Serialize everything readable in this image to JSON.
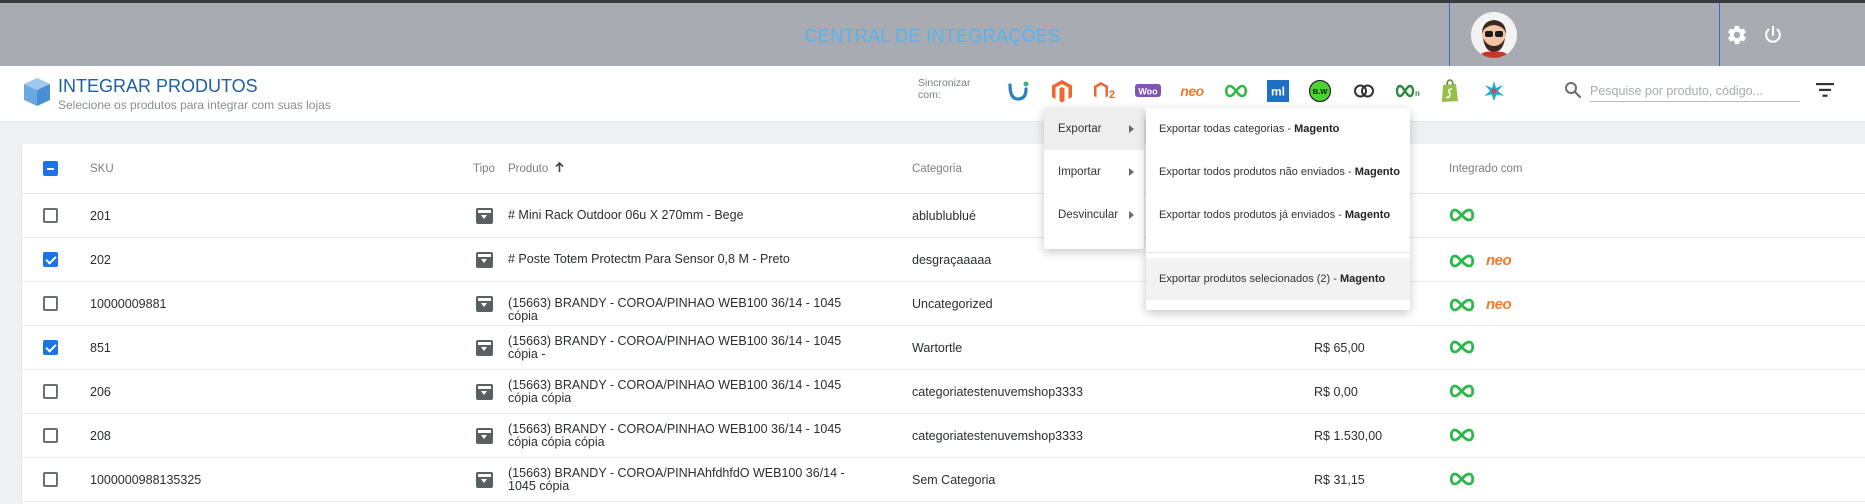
{
  "topbar": {
    "title": "CENTRAL DE INTEGRAÇÕES"
  },
  "header": {
    "title": "INTEGRAR PRODUTOS",
    "subtitle": "Selecione os produtos para integrar com suas lojas",
    "sync_label": "Sincronizar com:"
  },
  "integrations": [
    {
      "icon": "unified-icon",
      "text": ""
    },
    {
      "icon": "magento-icon",
      "text": ""
    },
    {
      "icon": "magento2-icon",
      "text": "2"
    },
    {
      "icon": "woocommerce-icon",
      "text": "Woo"
    },
    {
      "icon": "neo-icon",
      "text": "neo"
    },
    {
      "icon": "infinity-icon",
      "text": ""
    },
    {
      "icon": "mercadolivre-icon",
      "text": "ml"
    },
    {
      "icon": "bw-icon",
      "text": "B.W"
    },
    {
      "icon": "links-icon",
      "text": ""
    },
    {
      "icon": "infinity-n-icon",
      "text": "n"
    },
    {
      "icon": "shopify-icon",
      "text": ""
    },
    {
      "icon": "star-icon",
      "text": ""
    }
  ],
  "search": {
    "placeholder": "Pesquise por produto, código..."
  },
  "table": {
    "headers": {
      "sku": "SKU",
      "tipo": "Tipo",
      "produto": "Produto",
      "categoria": "Categoria",
      "integrado": "Integrado com"
    },
    "rows": [
      {
        "checked": false,
        "sku": "201",
        "produto": "# Mini Rack Outdoor 06u X 270mm - Bege",
        "categoria": "ablublublué",
        "preco": "",
        "integ": [
          "infinity"
        ]
      },
      {
        "checked": true,
        "sku": "202",
        "produto": "# Poste Totem Protectm Para Sensor 0,8 M - Preto",
        "categoria": "desgraçaaaaa",
        "preco": "",
        "integ": [
          "infinity",
          "neo"
        ]
      },
      {
        "checked": false,
        "sku": "10000009881",
        "produto": "(15663) BRANDY - COROA/PINHAO WEB100 36/14 - 1045 cópia",
        "categoria": "Uncategorized",
        "preco": "",
        "integ": [
          "infinity",
          "neo"
        ]
      },
      {
        "checked": true,
        "sku": "851",
        "produto": "(15663) BRANDY - COROA/PINHAO WEB100 36/14 - 1045 cópia -",
        "categoria": "Wartortle",
        "preco": "R$ 65,00",
        "integ": [
          "infinity"
        ]
      },
      {
        "checked": false,
        "sku": "206",
        "produto": "(15663) BRANDY - COROA/PINHAO WEB100 36/14 - 1045 cópia cópia",
        "categoria": "categoriatestenuvemshop3333",
        "preco": "R$ 0,00",
        "integ": [
          "infinity"
        ]
      },
      {
        "checked": false,
        "sku": "208",
        "produto": "(15663) BRANDY - COROA/PINHAO WEB100 36/14 - 1045 cópia cópia cópia",
        "categoria": "categoriatestenuvemshop3333",
        "preco": "R$ 1.530,00",
        "integ": [
          "infinity"
        ]
      },
      {
        "checked": false,
        "sku": "1000000988135325",
        "produto": "(15663) BRANDY - COROA/PINHAhfdhfdO WEB100 36/14 - 1045 cópia",
        "categoria": "Sem Categoria",
        "preco": "R$ 31,15",
        "integ": [
          "infinity"
        ]
      }
    ]
  },
  "menu": {
    "items": [
      {
        "label": "Exportar"
      },
      {
        "label": "Importar"
      },
      {
        "label": "Desvincular"
      }
    ],
    "submenu": [
      {
        "text": "Exportar todas categorias - ",
        "bold": "Magento"
      },
      {
        "text": "Exportar todos produtos não enviados - ",
        "bold": "Magento"
      },
      {
        "text": "Exportar todos produtos já enviados - ",
        "bold": "Magento"
      },
      {
        "text": "Exportar produtos selecionados (2) - ",
        "bold": "Magento"
      }
    ]
  },
  "colors": {
    "primary": "#1a73e8",
    "title": "#1d5fa8",
    "topbar": "#a9abb3",
    "integration_green": "#2db84b",
    "neo_orange": "#f07b2a"
  }
}
